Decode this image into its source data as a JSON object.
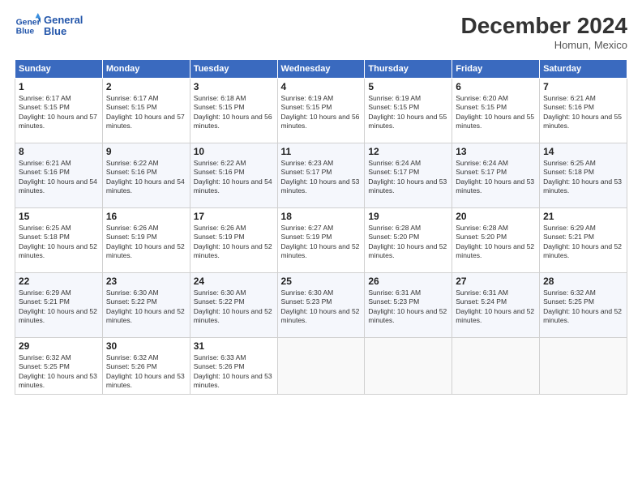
{
  "header": {
    "logo_line1": "General",
    "logo_line2": "Blue",
    "month": "December 2024",
    "location": "Homun, Mexico"
  },
  "weekdays": [
    "Sunday",
    "Monday",
    "Tuesday",
    "Wednesday",
    "Thursday",
    "Friday",
    "Saturday"
  ],
  "weeks": [
    [
      {
        "day": "1",
        "sunrise": "6:17 AM",
        "sunset": "5:15 PM",
        "daylight": "10 hours and 57 minutes."
      },
      {
        "day": "2",
        "sunrise": "6:17 AM",
        "sunset": "5:15 PM",
        "daylight": "10 hours and 57 minutes."
      },
      {
        "day": "3",
        "sunrise": "6:18 AM",
        "sunset": "5:15 PM",
        "daylight": "10 hours and 56 minutes."
      },
      {
        "day": "4",
        "sunrise": "6:19 AM",
        "sunset": "5:15 PM",
        "daylight": "10 hours and 56 minutes."
      },
      {
        "day": "5",
        "sunrise": "6:19 AM",
        "sunset": "5:15 PM",
        "daylight": "10 hours and 55 minutes."
      },
      {
        "day": "6",
        "sunrise": "6:20 AM",
        "sunset": "5:15 PM",
        "daylight": "10 hours and 55 minutes."
      },
      {
        "day": "7",
        "sunrise": "6:21 AM",
        "sunset": "5:16 PM",
        "daylight": "10 hours and 55 minutes."
      }
    ],
    [
      {
        "day": "8",
        "sunrise": "6:21 AM",
        "sunset": "5:16 PM",
        "daylight": "10 hours and 54 minutes."
      },
      {
        "day": "9",
        "sunrise": "6:22 AM",
        "sunset": "5:16 PM",
        "daylight": "10 hours and 54 minutes."
      },
      {
        "day": "10",
        "sunrise": "6:22 AM",
        "sunset": "5:16 PM",
        "daylight": "10 hours and 54 minutes."
      },
      {
        "day": "11",
        "sunrise": "6:23 AM",
        "sunset": "5:17 PM",
        "daylight": "10 hours and 53 minutes."
      },
      {
        "day": "12",
        "sunrise": "6:24 AM",
        "sunset": "5:17 PM",
        "daylight": "10 hours and 53 minutes."
      },
      {
        "day": "13",
        "sunrise": "6:24 AM",
        "sunset": "5:17 PM",
        "daylight": "10 hours and 53 minutes."
      },
      {
        "day": "14",
        "sunrise": "6:25 AM",
        "sunset": "5:18 PM",
        "daylight": "10 hours and 53 minutes."
      }
    ],
    [
      {
        "day": "15",
        "sunrise": "6:25 AM",
        "sunset": "5:18 PM",
        "daylight": "10 hours and 52 minutes."
      },
      {
        "day": "16",
        "sunrise": "6:26 AM",
        "sunset": "5:19 PM",
        "daylight": "10 hours and 52 minutes."
      },
      {
        "day": "17",
        "sunrise": "6:26 AM",
        "sunset": "5:19 PM",
        "daylight": "10 hours and 52 minutes."
      },
      {
        "day": "18",
        "sunrise": "6:27 AM",
        "sunset": "5:19 PM",
        "daylight": "10 hours and 52 minutes."
      },
      {
        "day": "19",
        "sunrise": "6:28 AM",
        "sunset": "5:20 PM",
        "daylight": "10 hours and 52 minutes."
      },
      {
        "day": "20",
        "sunrise": "6:28 AM",
        "sunset": "5:20 PM",
        "daylight": "10 hours and 52 minutes."
      },
      {
        "day": "21",
        "sunrise": "6:29 AM",
        "sunset": "5:21 PM",
        "daylight": "10 hours and 52 minutes."
      }
    ],
    [
      {
        "day": "22",
        "sunrise": "6:29 AM",
        "sunset": "5:21 PM",
        "daylight": "10 hours and 52 minutes."
      },
      {
        "day": "23",
        "sunrise": "6:30 AM",
        "sunset": "5:22 PM",
        "daylight": "10 hours and 52 minutes."
      },
      {
        "day": "24",
        "sunrise": "6:30 AM",
        "sunset": "5:22 PM",
        "daylight": "10 hours and 52 minutes."
      },
      {
        "day": "25",
        "sunrise": "6:30 AM",
        "sunset": "5:23 PM",
        "daylight": "10 hours and 52 minutes."
      },
      {
        "day": "26",
        "sunrise": "6:31 AM",
        "sunset": "5:23 PM",
        "daylight": "10 hours and 52 minutes."
      },
      {
        "day": "27",
        "sunrise": "6:31 AM",
        "sunset": "5:24 PM",
        "daylight": "10 hours and 52 minutes."
      },
      {
        "day": "28",
        "sunrise": "6:32 AM",
        "sunset": "5:25 PM",
        "daylight": "10 hours and 52 minutes."
      }
    ],
    [
      {
        "day": "29",
        "sunrise": "6:32 AM",
        "sunset": "5:25 PM",
        "daylight": "10 hours and 53 minutes."
      },
      {
        "day": "30",
        "sunrise": "6:32 AM",
        "sunset": "5:26 PM",
        "daylight": "10 hours and 53 minutes."
      },
      {
        "day": "31",
        "sunrise": "6:33 AM",
        "sunset": "5:26 PM",
        "daylight": "10 hours and 53 minutes."
      },
      null,
      null,
      null,
      null
    ]
  ]
}
